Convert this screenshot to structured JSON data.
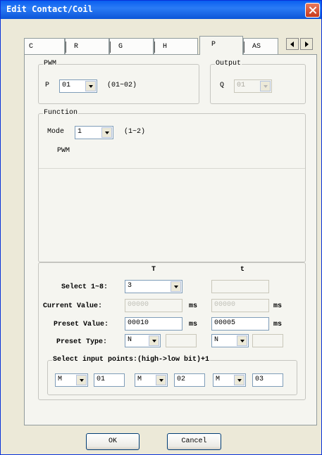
{
  "window": {
    "title": "Edit Contact/Coil"
  },
  "tabs": [
    "C",
    "R",
    "G",
    "H",
    "P",
    "AS"
  ],
  "active_tab": "P",
  "pwm": {
    "legend": "PWM",
    "label": "P",
    "value": "01",
    "range": "(01~02)"
  },
  "output": {
    "legend": "Output",
    "label": "Q",
    "value": "01"
  },
  "function": {
    "legend": "Function",
    "mode_label": "Mode",
    "mode_value": "1",
    "mode_range": "(1~2)",
    "mode_name": "PWM"
  },
  "timing": {
    "col_T": "T",
    "col_t": "t",
    "select_label": "Select 1~8:",
    "select_value": "3",
    "current_label": "Current Value:",
    "current_T": "00000",
    "current_t": "00000",
    "preset_label": "Preset Value:",
    "preset_T": "00010",
    "preset_t": "00005",
    "unit_ms": "ms",
    "type_label": "Preset Type:",
    "type_T": "N",
    "type_t": "N"
  },
  "inputs": {
    "legend": "Select input points:(high->low bit)+1",
    "points": [
      {
        "type": "M",
        "num": "01"
      },
      {
        "type": "M",
        "num": "02"
      },
      {
        "type": "M",
        "num": "03"
      }
    ]
  },
  "buttons": {
    "ok": "OK",
    "cancel": "Cancel"
  }
}
